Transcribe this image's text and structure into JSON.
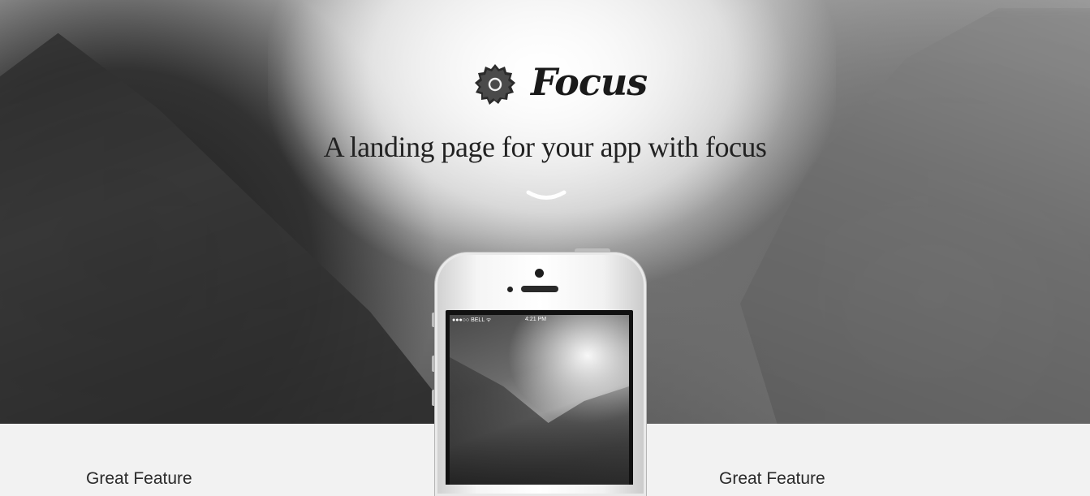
{
  "header": {
    "brand": "Focus",
    "tagline": "A landing page for your app with focus"
  },
  "phone": {
    "status_carrier": "●●●○○ BELL ᯤ",
    "status_time": "4:21 PM"
  },
  "features": [
    {
      "title": "Great Feature"
    },
    {
      "title": "Great Feature"
    }
  ],
  "icons": {
    "logo": "camera-lens-badge-icon",
    "scroll": "chevron-down-icon"
  }
}
